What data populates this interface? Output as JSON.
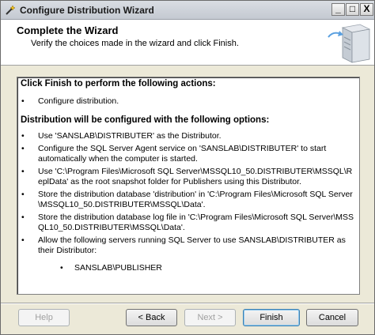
{
  "window": {
    "title": "Configure Distribution Wizard",
    "controls": {
      "minimize": "_",
      "maximize": "□",
      "close": "X"
    }
  },
  "header": {
    "title": "Complete the Wizard",
    "subtitle": "Verify the choices made in the wizard and click Finish."
  },
  "report": {
    "section1_title": "Click Finish to perform the following actions:",
    "section1_items": [
      "Configure distribution."
    ],
    "section2_title": "Distribution will be configured with the following options:",
    "section2_items": [
      "Use 'SANSLAB\\DISTRIBUTER' as the Distributor.",
      "Configure the SQL Server Agent service on 'SANSLAB\\DISTRIBUTER' to start automatically when the computer is started.",
      "Use 'C:\\Program Files\\Microsoft SQL Server\\MSSQL10_50.DISTRIBUTER\\MSSQL\\ReplData' as the root snapshot folder for Publishers using this Distributor.",
      "Store the distribution database 'distribution' in 'C:\\Program Files\\Microsoft SQL Server\\MSSQL10_50.DISTRIBUTER\\MSSQL\\Data'.",
      "Store the distribution database log file in 'C:\\Program Files\\Microsoft SQL Server\\MSSQL10_50.DISTRIBUTER\\MSSQL\\Data'.",
      "Allow the following servers running SQL Server to use SANSLAB\\DISTRIBUTER as their Distributor:"
    ],
    "publishers": [
      "SANSLAB\\PUBLISHER"
    ],
    "bullet": "•"
  },
  "buttons": {
    "help": "Help",
    "back": "< Back",
    "next": "Next >",
    "finish": "Finish",
    "cancel": "Cancel"
  },
  "icons": {
    "app": "wizard-icon",
    "header": "server-icon"
  }
}
